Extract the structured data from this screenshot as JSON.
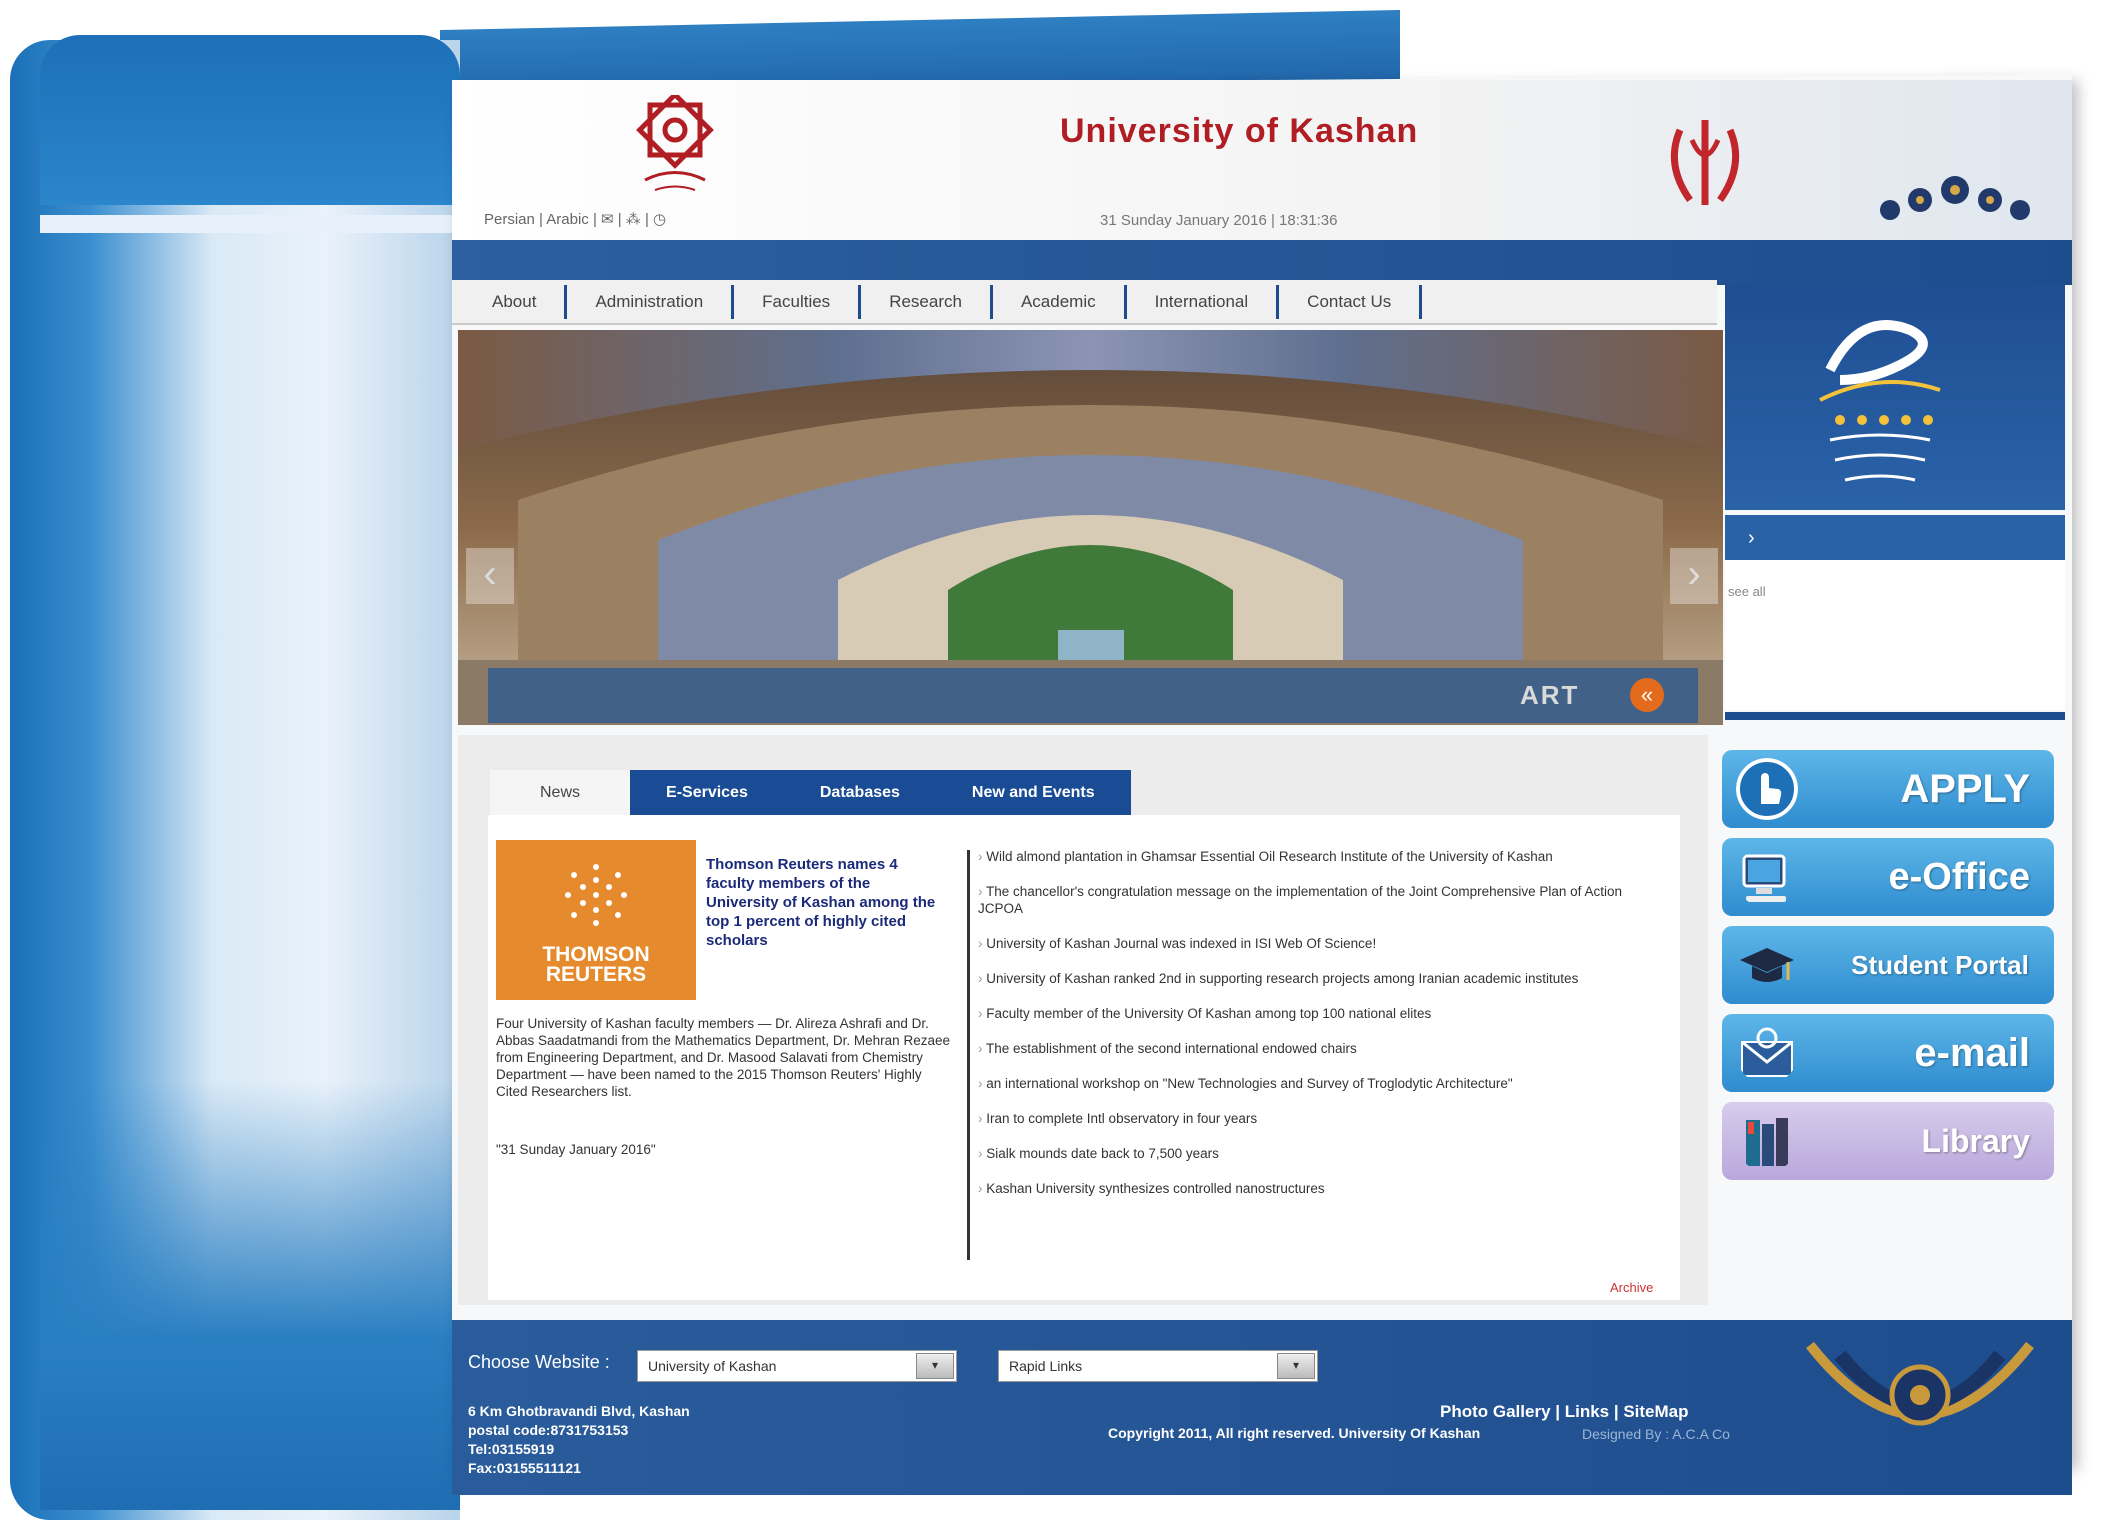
{
  "header": {
    "title": "University of Kashan",
    "top_links": "Persian  |  Arabic  |  ✉  |  ⁂  |  ◷",
    "datetime": "31 Sunday January 2016   |   18:31:36"
  },
  "nav": {
    "items": [
      "About",
      "Administration",
      "Faculties",
      "Research",
      "Academic",
      "International",
      "Contact Us"
    ]
  },
  "slider": {
    "caption": "ART",
    "prev_glyph": "‹",
    "next_glyph": "›",
    "arrow_glyph": "«"
  },
  "right_panel": {
    "see_all": "see all",
    "chevron": "›"
  },
  "tabs": [
    "News",
    "E-Services",
    "Databases",
    "New and Events"
  ],
  "feature": {
    "logo_text_1": "THOMSON",
    "logo_text_2": "REUTERS",
    "title": "Thomson Reuters names 4 faculty members of the University of Kashan among the top 1 percent of highly cited scholars",
    "body": "Four University of Kashan faculty members — Dr. Alireza Ashrafi and Dr. Abbas Saadatmandi from the Mathematics Department, Dr. Mehran Rezaee from Engineering Department, and Dr. Masood Salavati from Chemistry Department — have been named to the 2015 Thomson Reuters' Highly Cited Researchers list.",
    "date": "\"31 Sunday January 2016\""
  },
  "news_list": [
    "Wild almond plantation in Ghamsar Essential Oil Research Institute of the University of Kashan",
    "The chancellor's congratulation message on the implementation of the Joint Comprehensive Plan of Action JCPOA",
    "University of Kashan Journal was indexed in ISI Web Of Science!",
    "University of Kashan ranked 2nd in supporting research projects among Iranian academic institutes",
    "Faculty member of the University Of Kashan among top 100 national elites",
    "The establishment of the second international endowed chairs",
    "an international workshop on \"New Technologies and Survey of Troglodytic Architecture\"",
    "Iran to complete Intl observatory in four years",
    "Sialk mounds date back to 7,500 years",
    "Kashan University synthesizes controlled nanostructures"
  ],
  "archive": "Archive",
  "quick_links": {
    "apply": "APPLY",
    "eoffice": "e-Office",
    "student_portal": "Student Portal",
    "email": "e-mail",
    "library": "Library"
  },
  "footer": {
    "choose_label": "Choose Website :",
    "select_site": "University of Kashan",
    "select_links": "Rapid Links",
    "select_btn": "▾",
    "address_1": "6 Km Ghotbravandi Blvd, Kashan",
    "address_2": "postal code:8731753153",
    "address_3": "Tel:03155919",
    "address_4": "Fax:03155511121",
    "links": "Photo Gallery   |   Links   |   SiteMap",
    "copyright": "Copyright 2011, All right reserved. University Of Kashan",
    "designed": "Designed By : A.C.A Co"
  },
  "colors": {
    "brand_blue": "#1e4d8d",
    "title_red": "#b01e24",
    "tab_blue": "#1a4c95",
    "thomson_orange": "#e68a2e",
    "button_blue": "#2e8ccf"
  },
  "icons": [
    "university-logo-icon",
    "iran-emblem-icon",
    "hand-pointer-icon",
    "computer-icon",
    "graduation-cap-icon",
    "envelope-icon",
    "books-icon"
  ]
}
